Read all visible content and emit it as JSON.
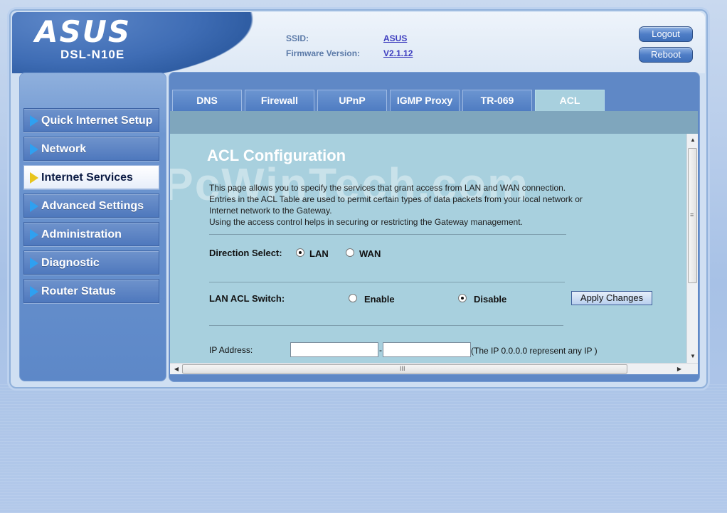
{
  "header": {
    "brand": "ASUS",
    "model": "DSL-N10E",
    "ssid_label": "SSID:",
    "ssid_value": "ASUS",
    "firmware_label": "Firmware Version:",
    "firmware_value": "V2.1.12",
    "logout_label": "Logout",
    "reboot_label": "Reboot"
  },
  "sidebar": {
    "items": [
      {
        "label": "Quick Internet Setup",
        "active": false
      },
      {
        "label": "Network",
        "active": false
      },
      {
        "label": "Internet Services",
        "active": true
      },
      {
        "label": "Advanced Settings",
        "active": false
      },
      {
        "label": "Administration",
        "active": false
      },
      {
        "label": "Diagnostic",
        "active": false
      },
      {
        "label": "Router Status",
        "active": false
      }
    ]
  },
  "tabs": [
    {
      "label": "DNS",
      "active": false
    },
    {
      "label": "Firewall",
      "active": false
    },
    {
      "label": "UPnP",
      "active": false
    },
    {
      "label": "IGMP Proxy",
      "active": false
    },
    {
      "label": "TR-069",
      "active": false
    },
    {
      "label": "ACL",
      "active": true
    }
  ],
  "content": {
    "watermark": "PcWinTech.com",
    "title": "ACL Configuration",
    "description": [
      "This page allows you to specify the services that grant access from LAN and WAN connection.",
      "Entries in the ACL Table are used to permit certain types of data packets from your local network or",
      "Internet network to the Gateway.",
      "Using the access control helps in securing or restricting the Gateway management."
    ],
    "direction_label": "Direction Select:",
    "direction_options": [
      {
        "label": "LAN",
        "checked": true
      },
      {
        "label": "WAN",
        "checked": false
      }
    ],
    "switch_label": "LAN ACL Switch:",
    "switch_options": [
      {
        "label": "Enable",
        "checked": false
      },
      {
        "label": "Disable",
        "checked": true
      }
    ],
    "apply_label": "Apply Changes",
    "ip_label": "IP Address:",
    "ip_start_value": "",
    "ip_end_value": "",
    "ip_separator": "-",
    "ip_note": "(The IP 0.0.0.0 represent any IP )"
  },
  "scrollbar": {
    "up_arrow": "▲",
    "down_arrow": "▼",
    "left_arrow": "◀",
    "right_arrow": "▶",
    "v_grip": "≡",
    "h_grip": "III"
  }
}
